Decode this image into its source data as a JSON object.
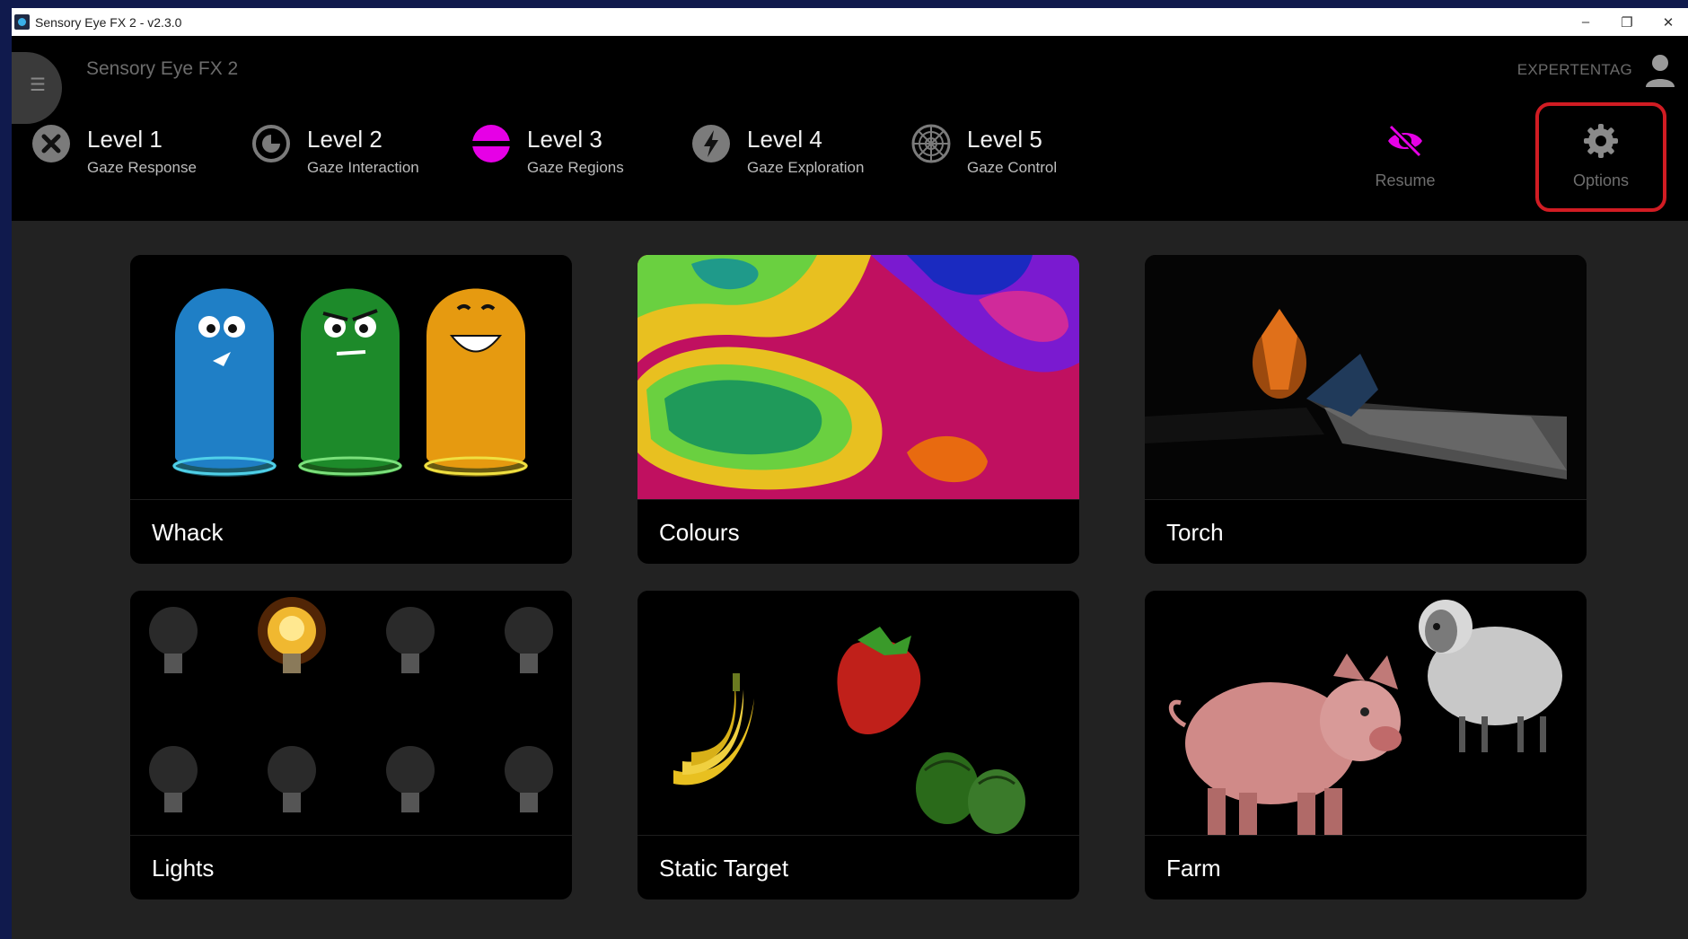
{
  "window": {
    "title": "Sensory Eye FX 2 - v2.3.0",
    "controls": {
      "minimize": "–",
      "restore": "❐",
      "close": "✕"
    }
  },
  "appbar": {
    "title": "Sensory Eye FX 2",
    "user": "EXPERTENTAG",
    "levels": [
      {
        "title": "Level 1",
        "subtitle": "Gaze Response",
        "icon": "close-circle-icon"
      },
      {
        "title": "Level 2",
        "subtitle": "Gaze Interaction",
        "icon": "target-circle-icon"
      },
      {
        "title": "Level 3",
        "subtitle": "Gaze Regions",
        "icon": "regions-icon",
        "active": true
      },
      {
        "title": "Level 4",
        "subtitle": "Gaze Exploration",
        "icon": "lightning-icon"
      },
      {
        "title": "Level 5",
        "subtitle": "Gaze Control",
        "icon": "web-icon"
      }
    ],
    "resume_label": "Resume",
    "options_label": "Options"
  },
  "activities": [
    {
      "label": "Whack"
    },
    {
      "label": "Colours"
    },
    {
      "label": "Torch"
    },
    {
      "label": "Lights"
    },
    {
      "label": "Static Target"
    },
    {
      "label": "Farm"
    }
  ],
  "colors": {
    "accent": "#e600e6",
    "highlight_border": "#d11c23",
    "background": "#222222",
    "toolbar": "#000000"
  }
}
